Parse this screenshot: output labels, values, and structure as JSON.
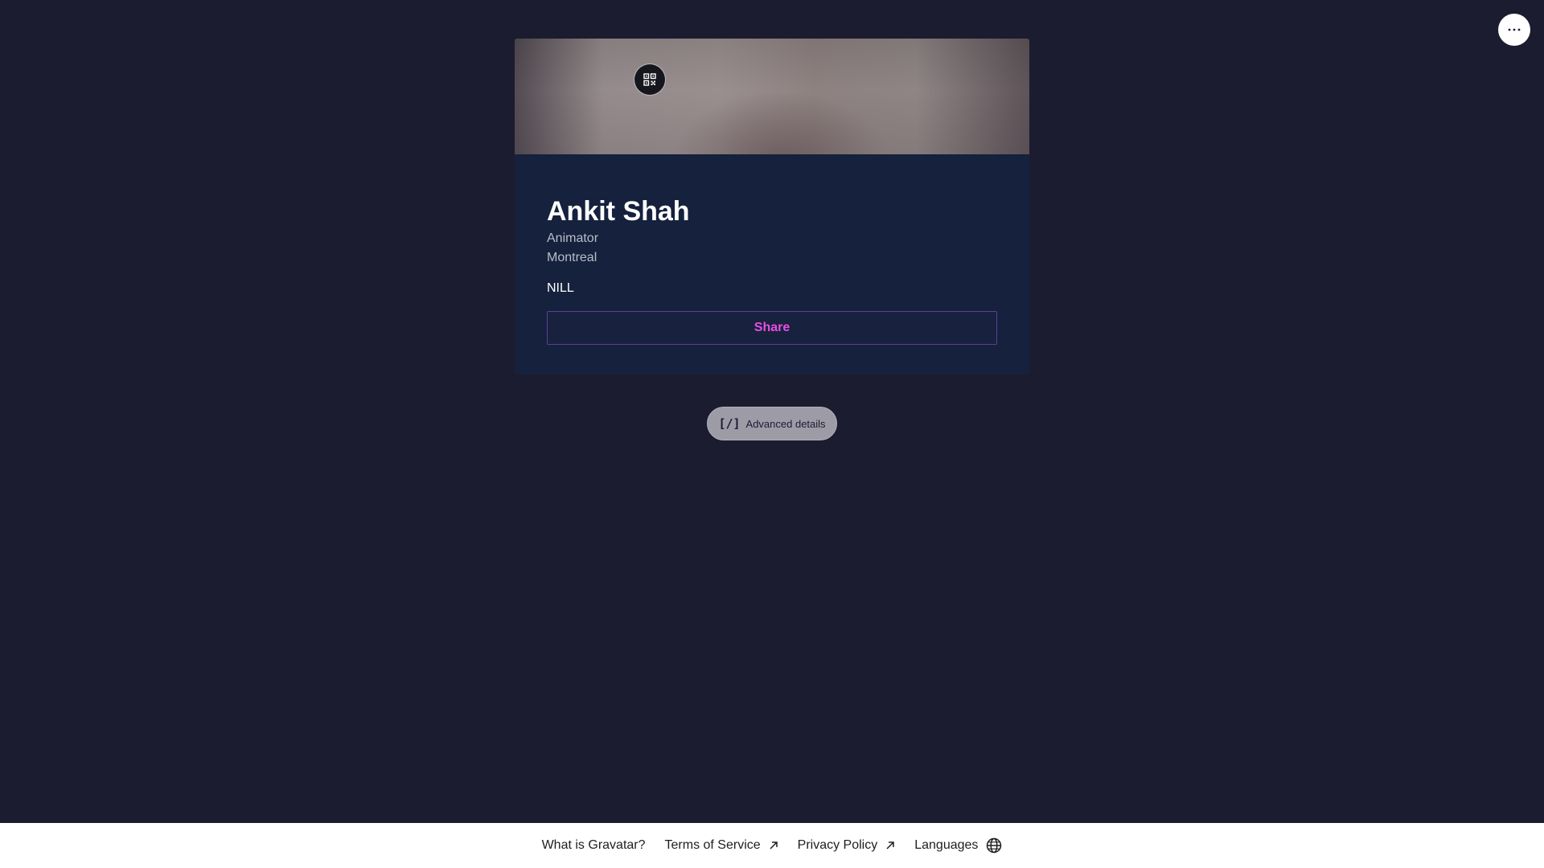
{
  "top_bar": {
    "more_icon": "more-horizontal-icon"
  },
  "profile": {
    "header_icon": "qr-code-icon",
    "name": "Ankit Shah",
    "job_title": "Animator",
    "location": "Montreal",
    "bio": "NILL",
    "share_label": "Share"
  },
  "advanced": {
    "icon": "[/]",
    "label": "Advanced details"
  },
  "footer": {
    "links": [
      {
        "label": "What is Gravatar?",
        "icon": ""
      },
      {
        "label": "Terms of Service",
        "icon": "external-arrow-icon"
      },
      {
        "label": "Privacy Policy",
        "icon": "external-arrow-icon"
      },
      {
        "label": "Languages",
        "icon": "globe-icon"
      }
    ]
  },
  "colors": {
    "background": "#1c1c30",
    "card": "#15213d",
    "share_accent": "#e64fe3",
    "share_border": "#5a3f9a",
    "footer": "#ffffff"
  }
}
